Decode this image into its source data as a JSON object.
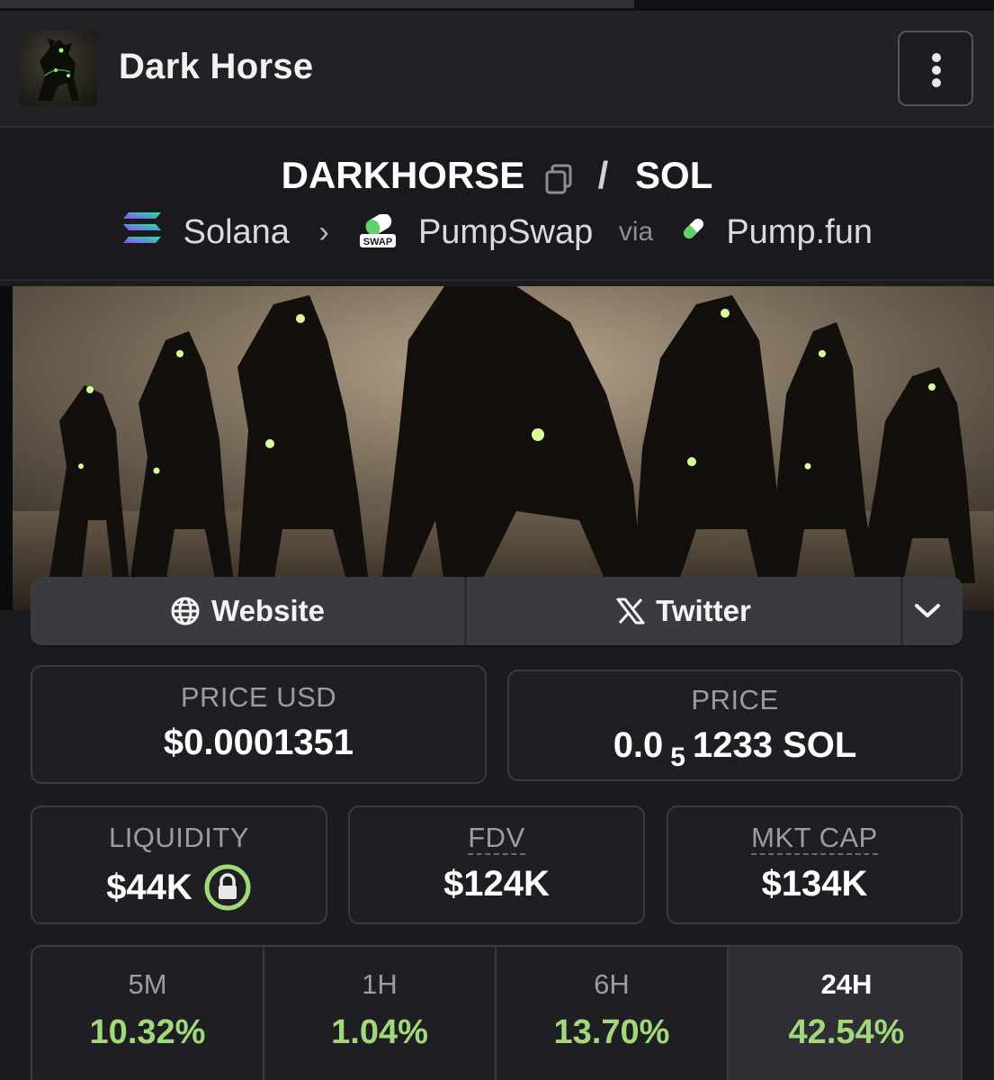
{
  "header": {
    "title": "Dark Horse",
    "menu_icon": "more-vertical-icon"
  },
  "pair": {
    "base": "DARKHORSE",
    "separator": "/",
    "quote": "SOL",
    "chain": "Solana",
    "dex": "PumpSwap",
    "dex_badge": "SWAP",
    "via": "via",
    "launchpad": "Pump.fun"
  },
  "links": {
    "website": "Website",
    "twitter": "Twitter"
  },
  "stats": {
    "price_usd_label": "PRICE USD",
    "price_usd": "$0.0001351",
    "price_label": "PRICE",
    "price_prefix": "0.0",
    "price_zeros": "5",
    "price_suffix": "1233 SOL",
    "liquidity_label": "LIQUIDITY",
    "liquidity": "$44K",
    "fdv_label": "FDV",
    "fdv": "$124K",
    "mktcap_label": "MKT CAP",
    "mktcap": "$134K"
  },
  "timeframes": [
    {
      "label": "5M",
      "value": "10.32%"
    },
    {
      "label": "1H",
      "value": "1.04%"
    },
    {
      "label": "6H",
      "value": "13.70%"
    },
    {
      "label": "24H",
      "value": "42.54%"
    }
  ],
  "colors": {
    "positive": "#a3d87a",
    "lock_ring": "#a3d87a",
    "background": "#1b1b20"
  }
}
